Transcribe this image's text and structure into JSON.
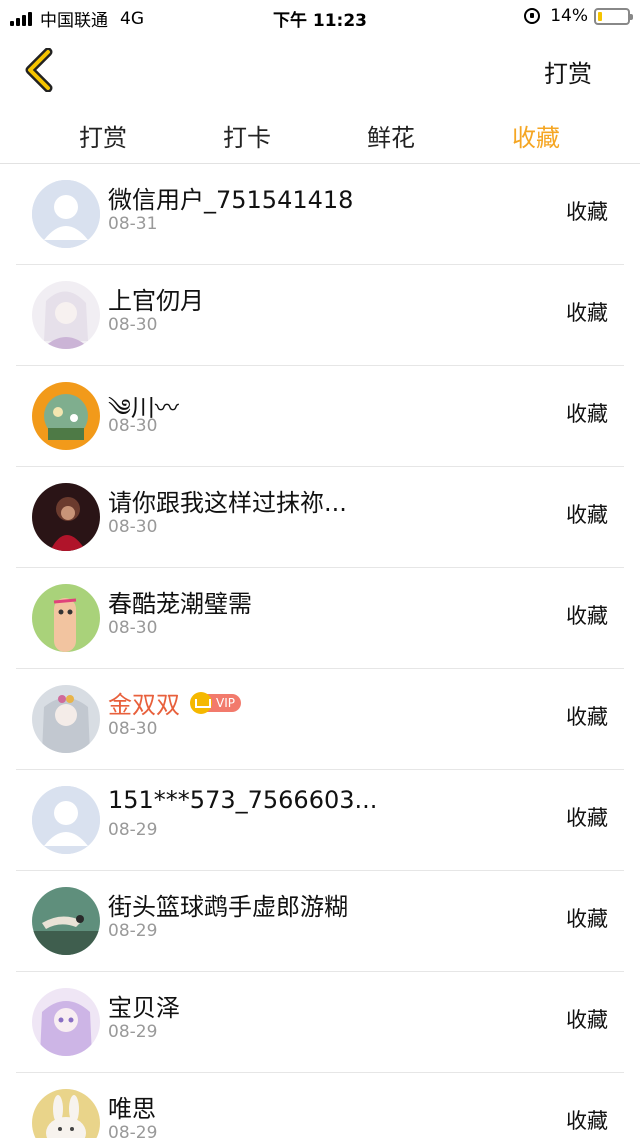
{
  "status_bar": {
    "carrier": "中国联通",
    "network": "4G",
    "time": "下午 11:23",
    "battery_text": "14%",
    "battery_level": 0.14
  },
  "nav": {
    "back_icon": "chevron-left-icon",
    "action_label": "打赏",
    "accent_color": "#f5a623"
  },
  "tabs": [
    {
      "label": "打赏",
      "active": false
    },
    {
      "label": "打卡",
      "active": false
    },
    {
      "label": "鲜花",
      "active": false
    },
    {
      "label": "收藏",
      "active": true
    }
  ],
  "list": [
    {
      "name": "微信用户_751541418",
      "date": "08-31",
      "action": "收藏",
      "avatar": "default-avatar-icon"
    },
    {
      "name": "上官仞月",
      "date": "08-30",
      "action": "收藏",
      "avatar": "anime-girl-avatar"
    },
    {
      "name": "༄川〰",
      "date": "08-30",
      "action": "收藏",
      "avatar": "illustration-avatar"
    },
    {
      "name": "请你跟我这样过抹祢...",
      "date": "08-30",
      "action": "收藏",
      "avatar": "photo-avatar"
    },
    {
      "name": "春酷茏潮璧需",
      "date": "08-30",
      "action": "收藏",
      "avatar": "finger-doodle-avatar"
    },
    {
      "name": "金双双",
      "date": "08-30",
      "action": "收藏",
      "avatar": "anime-avatar",
      "badge": "VIP"
    },
    {
      "name": "151***573_7566603...",
      "date": "08-29",
      "action": "收藏",
      "avatar": "default-avatar-icon"
    },
    {
      "name": "街头篮球鹉手虚郎游糊",
      "date": "08-29",
      "action": "收藏",
      "avatar": "bird-avatar"
    },
    {
      "name": "宝贝泽",
      "date": "08-29",
      "action": "收藏",
      "avatar": "anime-purple-avatar"
    },
    {
      "name": "唯思",
      "date": "08-29",
      "action": "收藏",
      "avatar": "rabbit-avatar"
    }
  ]
}
